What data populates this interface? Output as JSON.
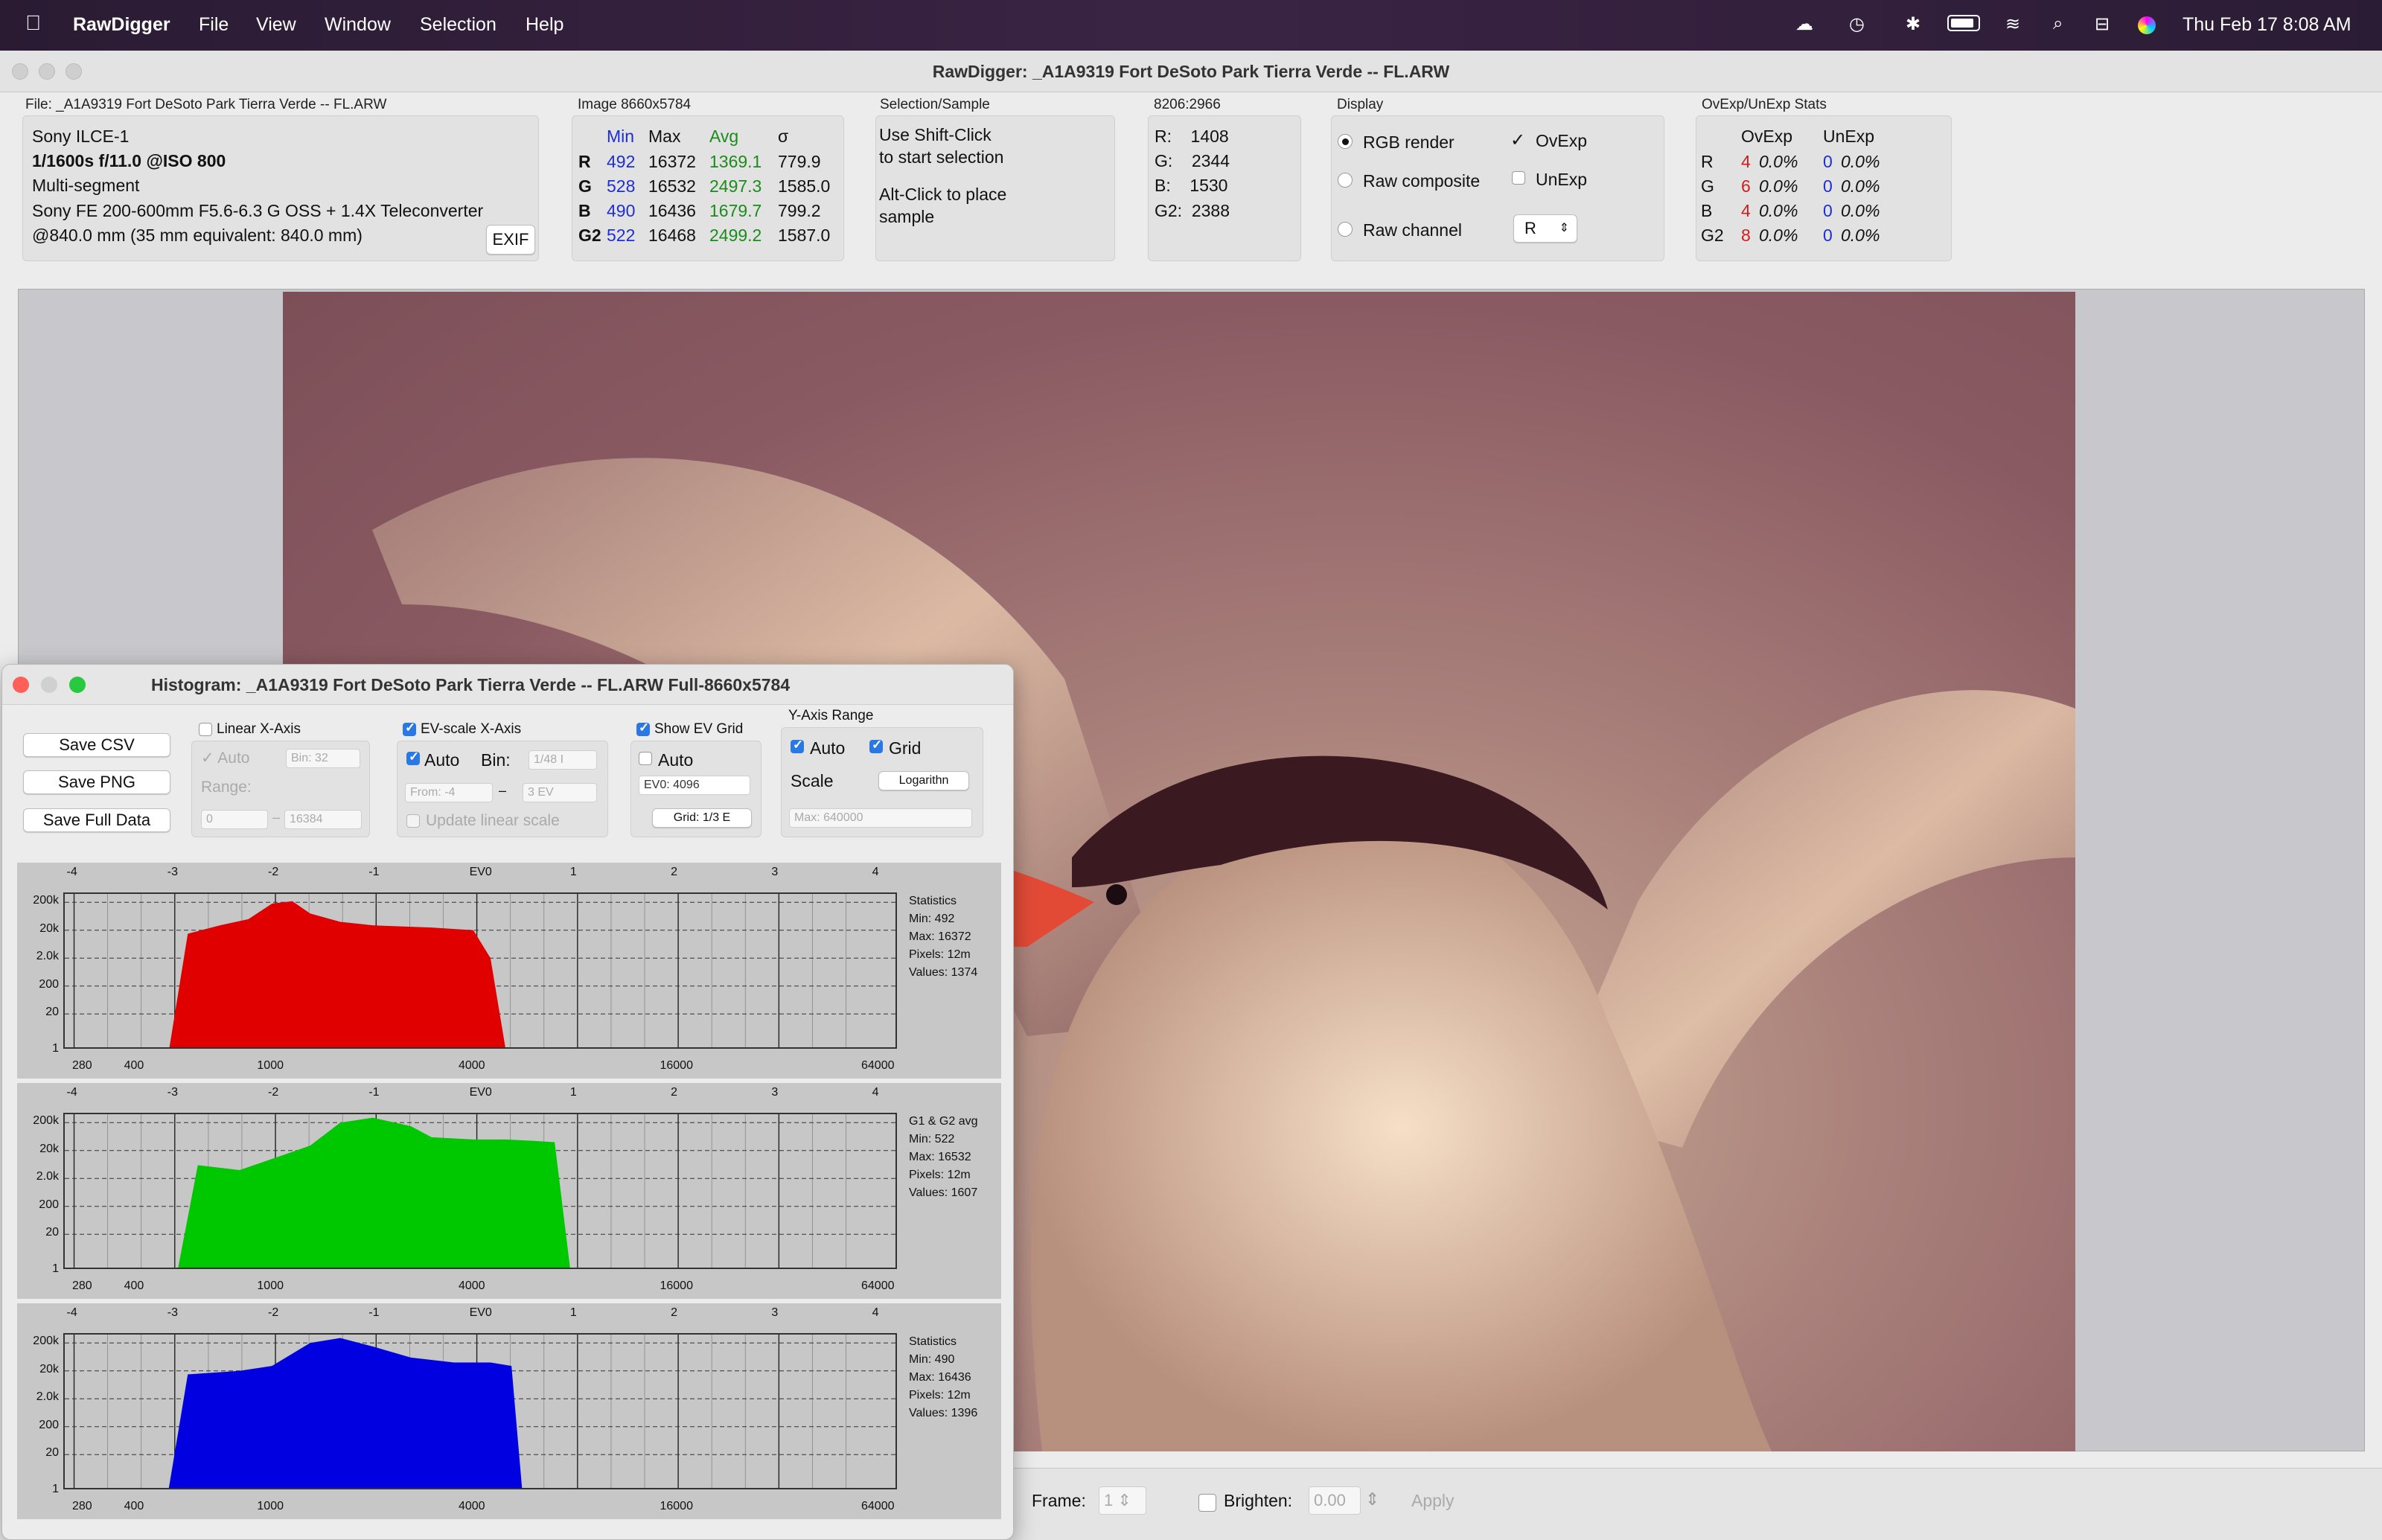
{
  "menubar": {
    "app": "RawDigger",
    "items": [
      "File",
      "View",
      "Window",
      "Selection",
      "Help"
    ],
    "datetime": "Thu Feb 17  8:08 AM"
  },
  "window": {
    "title": "RawDigger: _A1A9319 Fort DeSoto Park Tierra Verde -- FL.ARW"
  },
  "file_panel": {
    "header": "File: _A1A9319 Fort DeSoto Park Tierra Verde -- FL.ARW",
    "camera": "Sony ILCE-1",
    "exposure": "1/1600s f/11.0 @ISO 800",
    "metering": "Multi-segment",
    "lens": "Sony FE 200-600mm F5.6-6.3 G OSS + 1.4X Teleconverter",
    "focal": "@840.0 mm (35 mm equivalent: 840.0 mm)",
    "exif_button": "EXIF"
  },
  "image_panel": {
    "header": "Image 8660x5784",
    "cols": [
      "Min",
      "Max",
      "Avg",
      "σ"
    ],
    "rows": [
      {
        "ch": "R",
        "min": "492",
        "max": "16372",
        "avg": "1369.1",
        "sd": "779.9"
      },
      {
        "ch": "G",
        "min": "528",
        "max": "16532",
        "avg": "2497.3",
        "sd": "1585.0"
      },
      {
        "ch": "B",
        "min": "490",
        "max": "16436",
        "avg": "1679.7",
        "sd": "799.2"
      },
      {
        "ch": "G2",
        "min": "522",
        "max": "16468",
        "avg": "2499.2",
        "sd": "1587.0"
      }
    ]
  },
  "selection_panel": {
    "header": "Selection/Sample",
    "l1": "Use Shift-Click",
    "l2": "to start selection",
    "l3": "Alt-Click to place",
    "l4": "sample"
  },
  "coord_panel": {
    "header": "8206:2966",
    "r": "R:    1408",
    "g": "G:    2344",
    "b": "B:    1530",
    "g2": "G2:  2388"
  },
  "display_panel": {
    "header": "Display",
    "rgb": "RGB render",
    "comp": "Raw composite",
    "chan": "Raw channel",
    "ovexp": "OvExp",
    "unexp": "UnExp",
    "channel_select": "R"
  },
  "stats_panel": {
    "header": "OvExp/UnExp Stats",
    "col1": "OvExp",
    "col2": "UnExp",
    "rows": [
      {
        "ch": "R",
        "ov": "4",
        "ovp": "0.0%",
        "un": "0",
        "unp": "0.0%"
      },
      {
        "ch": "G",
        "ov": "6",
        "ovp": "0.0%",
        "un": "0",
        "unp": "0.0%"
      },
      {
        "ch": "B",
        "ov": "4",
        "ovp": "0.0%",
        "un": "0",
        "unp": "0.0%"
      },
      {
        "ch": "G2",
        "ov": "8",
        "ovp": "0.0%",
        "un": "0",
        "unp": "0.0%"
      }
    ]
  },
  "bottom": {
    "frame_label": "Frame:",
    "frame_value": "1",
    "brighten_label": "Brighten:",
    "brighten_value": "0.00",
    "apply": "Apply"
  },
  "histogram": {
    "title": "Histogram: _A1A9319 Fort DeSoto Park Tierra Verde -- FL.ARW Full-8660x5784",
    "save_csv": "Save CSV",
    "save_png": "Save PNG",
    "save_full": "Save Full Data",
    "linear": "Linear X-Axis",
    "auto": "Auto",
    "bin32": "Bin: 32",
    "range": "Range:",
    "r_from": "0",
    "r_to": "16384",
    "evscale": "EV-scale X-Axis",
    "auto2": "Auto",
    "bin": "Bin:",
    "bin_val": "1/48 I",
    "from": "From: -4",
    "to": "3 EV",
    "update": "Update linear scale",
    "showgrid": "Show EV Grid",
    "auto3": "Auto",
    "ev0": "EV0: 4096",
    "grid": "Grid: 1/3 E",
    "yrange": "Y-Axis Range",
    "auto4": "Auto",
    "grid2": "Grid",
    "scale": "Scale",
    "scale_val": "Logarithn",
    "max": "Max: 640000",
    "ev_ticks": [
      "-4",
      "-3",
      "-2",
      "-1",
      "EV0",
      "1",
      "2",
      "3",
      "4"
    ],
    "y_ticks": [
      "200k",
      "20k",
      "2.0k",
      "200",
      "20",
      "1"
    ],
    "x_ticks": [
      "280",
      "400",
      "1000",
      "4000",
      "16000",
      "64000"
    ]
  },
  "chart_data": [
    {
      "type": "area",
      "title": "",
      "channel": "R",
      "color": "#e00000",
      "x_scale": "log",
      "x_ticks": [
        280,
        400,
        1000,
        4000,
        16000,
        64000
      ],
      "y_scale": "log",
      "y_ticks": [
        "1",
        "20",
        "200",
        "2.0k",
        "20k",
        "200k"
      ],
      "x": [
        492,
        560,
        700,
        850,
        1000,
        1150,
        1300,
        1600,
        2000,
        3000,
        4000,
        4500,
        5000
      ],
      "y": [
        1,
        15000,
        30000,
        50000,
        180000,
        220000,
        80000,
        40000,
        30000,
        25000,
        20000,
        2000,
        1
      ],
      "stats": {
        "label": "Statistics",
        "min": "Min: 492",
        "max": "Max: 16372",
        "pixels": "Pixels: 12m",
        "values": "Values: 1374"
      }
    },
    {
      "type": "area",
      "title": "",
      "channel": "G",
      "color": "#00c800",
      "x_scale": "log",
      "x_ticks": [
        280,
        400,
        1000,
        4000,
        16000,
        64000
      ],
      "y_scale": "log",
      "y_ticks": [
        "1",
        "20",
        "200",
        "2.0k",
        "20k",
        "200k"
      ],
      "x": [
        522,
        600,
        800,
        1000,
        1300,
        1600,
        2000,
        2600,
        3000,
        4000,
        5000,
        6000,
        7000,
        7800
      ],
      "y": [
        1,
        6000,
        4000,
        10000,
        30000,
        200000,
        300000,
        150000,
        60000,
        50000,
        50000,
        45000,
        40000,
        1
      ],
      "stats": {
        "label": "G1 & G2 avg",
        "min": "Min: 522",
        "max": "Max: 16532",
        "pixels": "Pixels: 12m",
        "values": "Values: 1607"
      }
    },
    {
      "type": "area",
      "title": "",
      "channel": "B",
      "color": "#0000e0",
      "x_scale": "log",
      "x_ticks": [
        280,
        400,
        1000,
        4000,
        16000,
        64000
      ],
      "y_scale": "log",
      "y_ticks": [
        "1",
        "20",
        "200",
        "2.0k",
        "20k",
        "200k"
      ],
      "x": [
        490,
        560,
        800,
        1000,
        1300,
        1600,
        2000,
        2600,
        3500,
        4500,
        5200,
        5600
      ],
      "y": [
        1,
        15000,
        20000,
        30000,
        200000,
        300000,
        150000,
        60000,
        40000,
        40000,
        30000,
        1
      ],
      "stats": {
        "label": "Statistics",
        "min": "Min: 490",
        "max": "Max: 16436",
        "pixels": "Pixels: 12m",
        "values": "Values: 1396"
      }
    }
  ]
}
